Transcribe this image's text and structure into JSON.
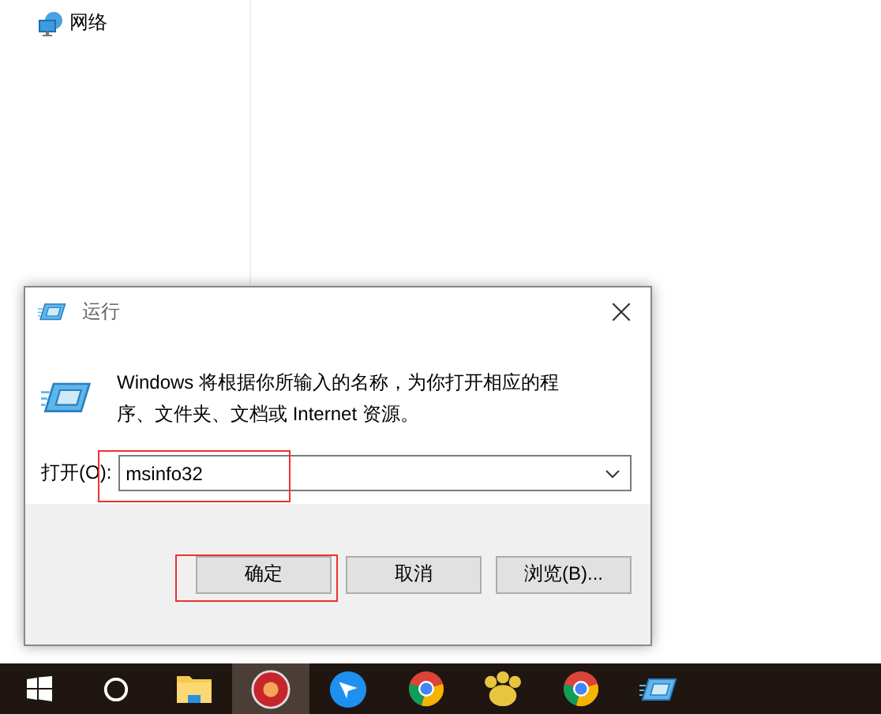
{
  "explorer": {
    "sidebar_item": {
      "label": "网络"
    }
  },
  "dialog": {
    "title": "运行",
    "description": "Windows 将根据你所输入的名称，为你打开相应的程序、文件夹、文档或 Internet 资源。",
    "open_label": "打开(O):",
    "open_value": "msinfo32",
    "field_highlighted": true,
    "buttons": [
      {
        "label": "确定",
        "highlighted": true
      },
      {
        "label": "取消",
        "highlighted": false
      },
      {
        "label": "浏览(B)...",
        "highlighted": false
      }
    ]
  },
  "taskbar": {
    "items": [
      {
        "kind": "start",
        "active": false
      },
      {
        "kind": "search",
        "active": false
      },
      {
        "kind": "folder",
        "active": false
      },
      {
        "kind": "redapp",
        "active": true
      },
      {
        "kind": "bird",
        "active": false
      },
      {
        "kind": "chrome",
        "active": false
      },
      {
        "kind": "paw",
        "active": false
      },
      {
        "kind": "chrome",
        "active": false
      },
      {
        "kind": "run",
        "active": false
      }
    ]
  }
}
